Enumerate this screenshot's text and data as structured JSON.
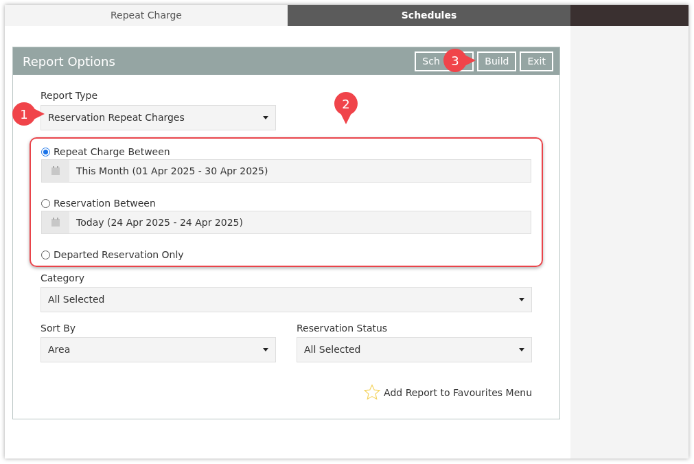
{
  "tabs": [
    {
      "label": "Repeat Charge",
      "selected": true
    },
    {
      "label": "Schedules",
      "selected": false
    }
  ],
  "panel": {
    "title": "Report Options",
    "buttons": [
      "Sch",
      "Build",
      "Exit"
    ]
  },
  "report_type": {
    "label": "Report Type",
    "value": "Reservation Repeat Charges"
  },
  "date_options": [
    {
      "label": "Repeat Charge Between",
      "selected": true,
      "kind": "range",
      "value": "This Month (01 Apr 2025 - 30 Apr 2025)"
    },
    {
      "label": "Reservation Between",
      "selected": false,
      "kind": "range",
      "value": "Today (24 Apr 2025 - 24 Apr 2025)"
    },
    {
      "label": "Departed Reservation Only",
      "selected": false,
      "kind": "plain"
    }
  ],
  "category": {
    "label": "Category",
    "value": "All Selected"
  },
  "sort_by": {
    "label": "Sort By",
    "value": "Area"
  },
  "reservation_status": {
    "label": "Reservation Status",
    "value": "All Selected"
  },
  "favourites_link": "Add Report to Favourites Menu",
  "callouts": [
    "1",
    "2",
    "3"
  ]
}
